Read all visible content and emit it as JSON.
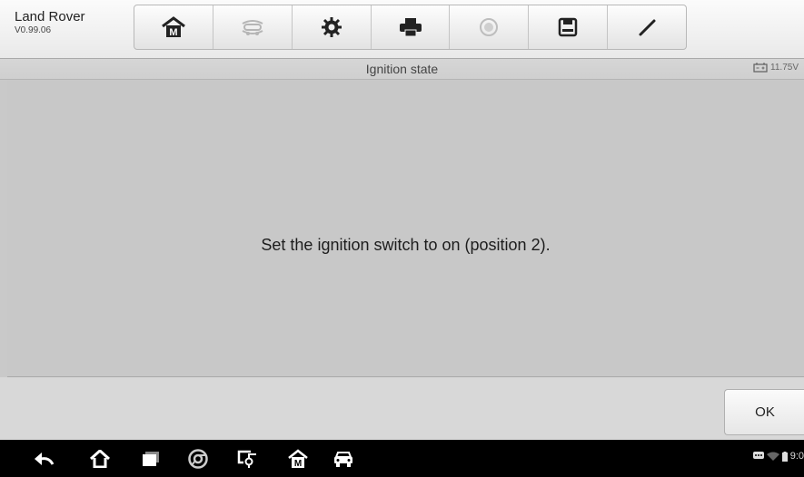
{
  "app": {
    "name": "Land Rover",
    "version": "V0.99.06"
  },
  "toolbar": {
    "buttons": [
      {
        "icon": "home-icon",
        "enabled": true
      },
      {
        "icon": "vehicle-swap-icon",
        "enabled": false
      },
      {
        "icon": "gear-icon",
        "enabled": true
      },
      {
        "icon": "printer-icon",
        "enabled": true
      },
      {
        "icon": "help-icon",
        "enabled": false
      },
      {
        "icon": "save-icon",
        "enabled": true
      },
      {
        "icon": "pen-icon",
        "enabled": true
      }
    ]
  },
  "header": {
    "title": "Ignition state",
    "battery_voltage": "11.75V"
  },
  "main": {
    "message": "Set the ignition switch to on (position 2)."
  },
  "actions": {
    "ok_label": "OK"
  },
  "statusbar": {
    "time": "9:0"
  },
  "colors": {
    "background": "#c9c9c9",
    "navbar": "#000000",
    "toolbar": "#f0f0f0"
  }
}
